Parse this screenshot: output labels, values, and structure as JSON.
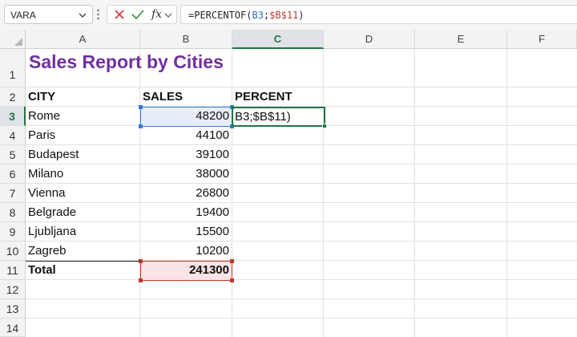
{
  "namebox": {
    "value": "VARA"
  },
  "formula": {
    "prefix": "=PERCENTOF(",
    "ref1": "B3",
    "sep": ";",
    "ref2": "$B$11",
    "suffix": ")"
  },
  "columns": [
    "A",
    "B",
    "C",
    "D",
    "E",
    "F"
  ],
  "rows": [
    "1",
    "2",
    "3",
    "4",
    "5",
    "6",
    "7",
    "8",
    "9",
    "10",
    "11",
    "12",
    "13",
    "14"
  ],
  "sheet": {
    "title": "Sales Report by Cities",
    "headers": {
      "city": "CITY",
      "sales": "SALES",
      "percent": "PERCENT"
    },
    "data": [
      {
        "city": "Rome",
        "sales": "48200"
      },
      {
        "city": "Paris",
        "sales": "44100"
      },
      {
        "city": "Budapest",
        "sales": "39100"
      },
      {
        "city": "Milano",
        "sales": "38000"
      },
      {
        "city": "Vienna",
        "sales": "26800"
      },
      {
        "city": "Belgrade",
        "sales": "19400"
      },
      {
        "city": "Ljubljana",
        "sales": "15500"
      },
      {
        "city": "Zagreb",
        "sales": "10200"
      }
    ],
    "total": {
      "label": "Total",
      "value": "241300"
    },
    "editing_text": "B3;$B$11)"
  },
  "colors": {
    "title": "#7030a0",
    "ref_blue": "#2f6fbd",
    "ref_red": "#c0392b",
    "accent": "#217346"
  }
}
